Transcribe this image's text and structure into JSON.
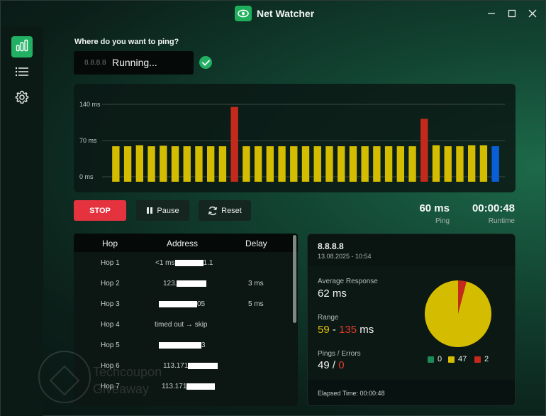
{
  "window": {
    "title": "Net Watcher",
    "app_icon": "eye-icon",
    "controls": [
      "minimize-icon",
      "maximize-icon",
      "close-icon"
    ]
  },
  "sidebar": {
    "items": [
      {
        "icon": "bar-chart-icon",
        "active": true
      },
      {
        "icon": "list-icon",
        "active": false
      },
      {
        "icon": "gear-icon",
        "active": false
      }
    ]
  },
  "ping": {
    "question": "Where do you want to ping?",
    "input_value": "8.8.8.8",
    "status": "Running...",
    "valid_icon": "check-icon"
  },
  "chart_data": {
    "type": "bar",
    "ytick_labels": [
      "140 ms",
      "70 ms",
      "0 ms"
    ],
    "ylim": [
      0,
      140
    ],
    "grid": true,
    "values": [
      59,
      59,
      61,
      59,
      60,
      59,
      59,
      59,
      59,
      59,
      135,
      59,
      59,
      59,
      59,
      59,
      59,
      59,
      59,
      59,
      59,
      59,
      59,
      59,
      59,
      59,
      112,
      61,
      59,
      59,
      61,
      61,
      59
    ],
    "colors": [
      "#d4bd00",
      "#d4bd00",
      "#d4bd00",
      "#d4bd00",
      "#d4bd00",
      "#d4bd00",
      "#d4bd00",
      "#d4bd00",
      "#d4bd00",
      "#d4bd00",
      "#c42a1c",
      "#d4bd00",
      "#d4bd00",
      "#d4bd00",
      "#d4bd00",
      "#d4bd00",
      "#d4bd00",
      "#d4bd00",
      "#d4bd00",
      "#d4bd00",
      "#d4bd00",
      "#d4bd00",
      "#d4bd00",
      "#d4bd00",
      "#d4bd00",
      "#d4bd00",
      "#c42a1c",
      "#d4bd00",
      "#d4bd00",
      "#d4bd00",
      "#d4bd00",
      "#d4bd00",
      "#0b5fd6"
    ]
  },
  "controls": {
    "stop_label": "STOP",
    "pause_label": "Pause",
    "pause_icon": "pause-icon",
    "reset_label": "Reset",
    "reset_icon": "refresh-icon",
    "stop_color": "#e5323f"
  },
  "stats": {
    "ping_value": "60 ms",
    "ping_label": "Ping",
    "runtime_value": "00:00:48",
    "runtime_label": "Runtime"
  },
  "hops": {
    "columns": [
      "Hop",
      "Address",
      "Delay"
    ],
    "rows": [
      {
        "hop": "Hop 1",
        "addr_pre": "<1 ms",
        "addr_post": "1.1",
        "delay": ""
      },
      {
        "hop": "Hop 2",
        "addr_pre": "123.",
        "addr_post": "",
        "delay": "3 ms"
      },
      {
        "hop": "Hop 3",
        "addr_pre": "",
        "addr_post": "05",
        "delay": "5 ms"
      },
      {
        "hop": "Hop 4",
        "addr_pre": "timed out → skip",
        "addr_post": "",
        "delay": ""
      },
      {
        "hop": "Hop 5",
        "addr_pre": "",
        "addr_post": "3",
        "delay": ""
      },
      {
        "hop": "Hop 6",
        "addr_pre": "113.171",
        "addr_post": "",
        "delay": ""
      },
      {
        "hop": "Hop 7",
        "addr_pre": "113.171",
        "addr_post": "",
        "delay": ""
      }
    ]
  },
  "detail": {
    "host": "8.8.8.8",
    "date": "13.08.2025 - 10:54",
    "avg_label": "Average Response",
    "avg_value": "62 ms",
    "range_label": "Range",
    "range_min": "59",
    "range_sep": " - ",
    "range_max": "135",
    "range_unit": " ms",
    "pings_label": "Pings / Errors",
    "pings_value": "49",
    "pings_sep": " / ",
    "errors_value": "0",
    "pie": {
      "values": [
        0,
        47,
        2
      ],
      "colors": [
        "#1a8a57",
        "#d4bd00",
        "#c42a1c"
      ],
      "labels": [
        "0",
        "47",
        "2"
      ]
    },
    "elapsed": "Elapsed Time: 00:00:48"
  },
  "watermark": {
    "line1": "Techcoupon",
    "line2": "Giveaway"
  }
}
